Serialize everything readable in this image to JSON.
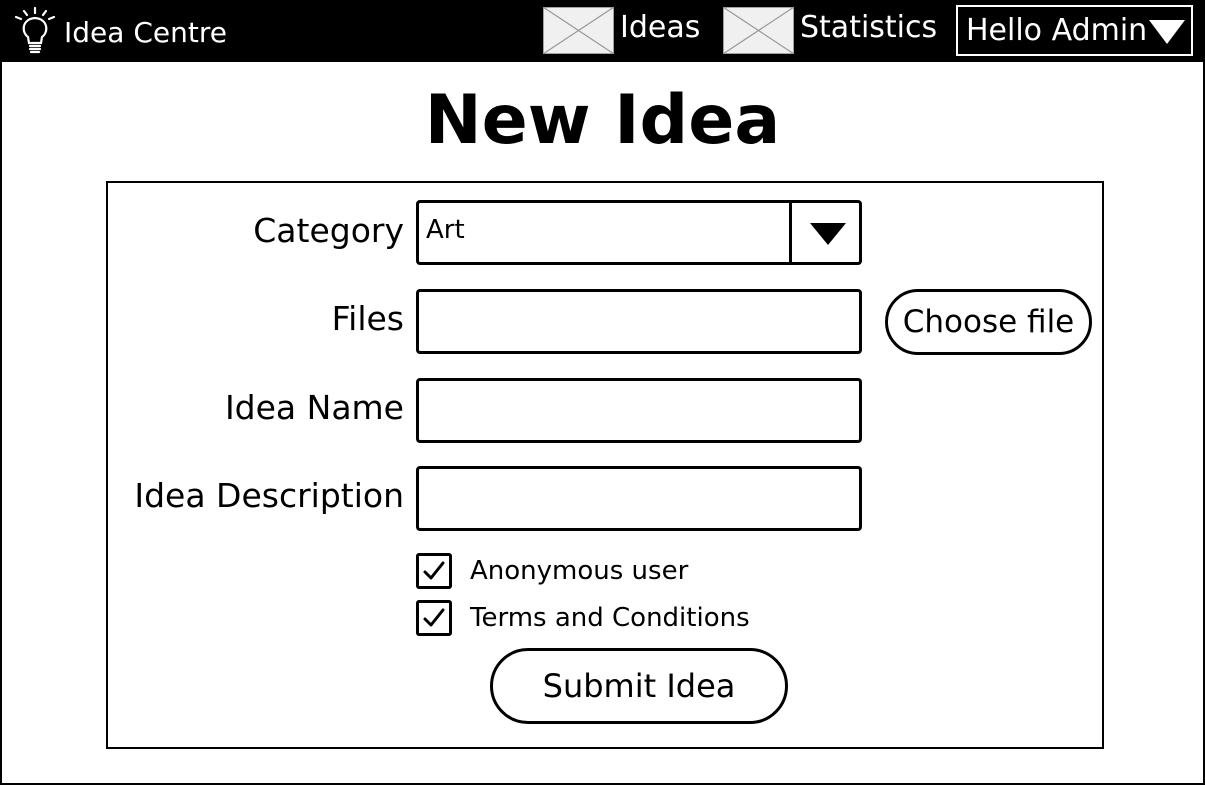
{
  "brand": {
    "name": "Idea Centre"
  },
  "nav": {
    "ideas_label": "Ideas",
    "statistics_label": "Statistics",
    "user_label": "Hello Admin"
  },
  "page": {
    "title": "New Idea"
  },
  "form": {
    "category_label": "Category",
    "category_value": "Art",
    "files_label": "Files",
    "files_value": "",
    "choose_file_label": "Choose file",
    "idea_name_label": "Idea Name",
    "idea_name_value": "",
    "idea_description_label": "Idea Description",
    "idea_description_value": "",
    "anonymous_label": "Anonymous user",
    "anonymous_checked": true,
    "terms_label": "Terms and Conditions",
    "terms_checked": true,
    "submit_label": "Submit Idea"
  },
  "colors": {
    "navbar_bg": "#000000",
    "navbar_text": "#ffffff",
    "border": "#000000",
    "background": "#ffffff"
  },
  "icons": {
    "brand": "lightbulb-icon",
    "ideas": "image-placeholder-icon",
    "statistics": "image-placeholder-icon",
    "user_menu": "caret-down-icon",
    "category": "caret-down-icon",
    "checkbox": "checkmark-icon"
  }
}
